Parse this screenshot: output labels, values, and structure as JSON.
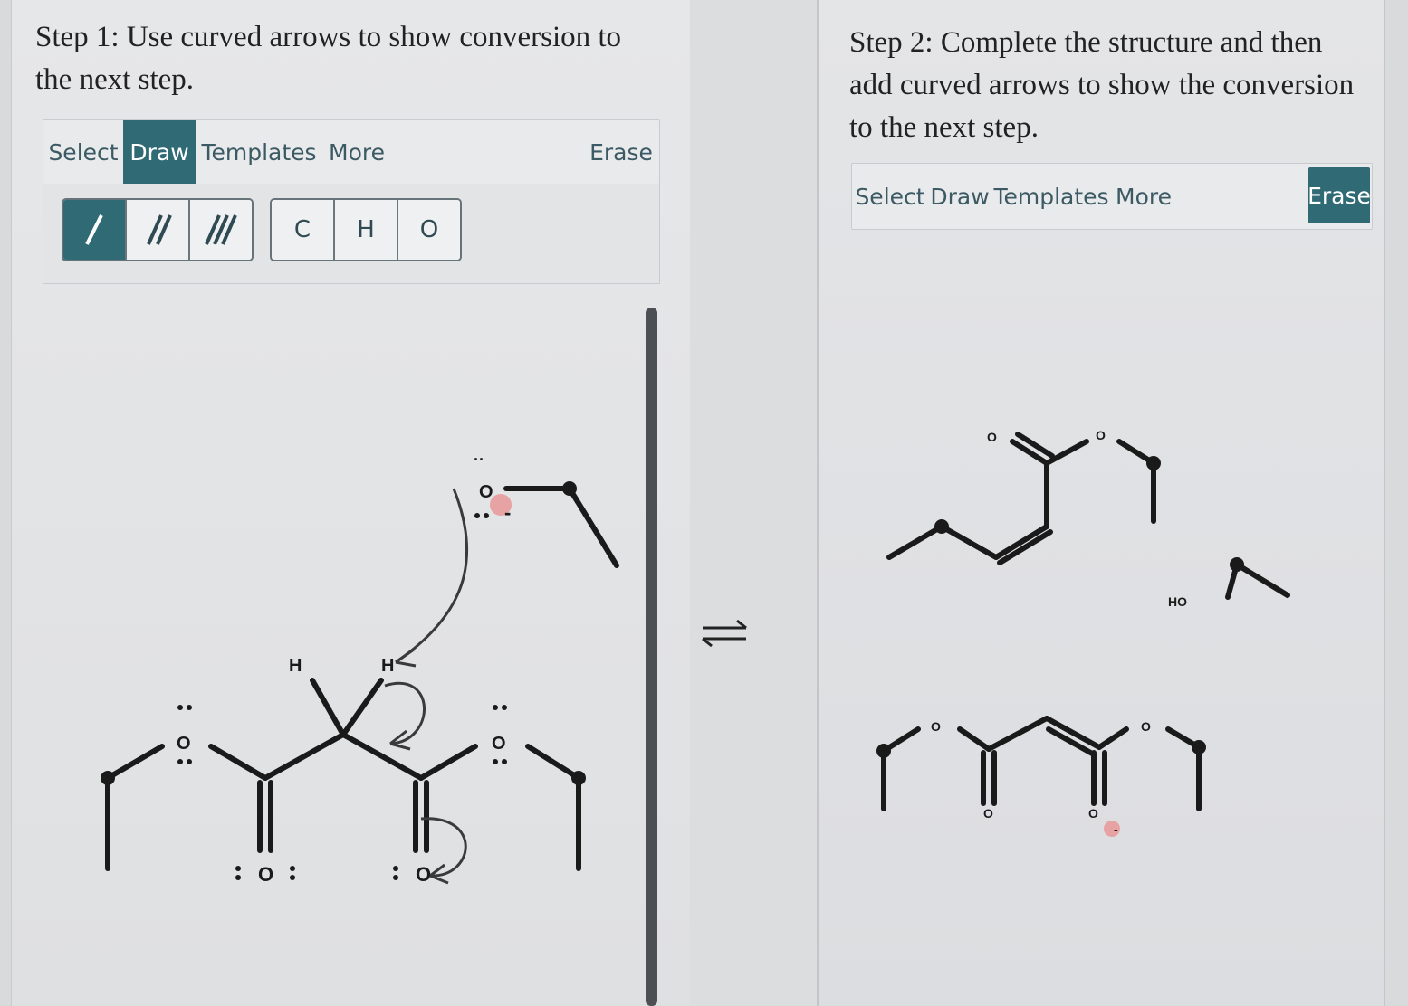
{
  "step1": {
    "title_line1": "Step 1: Use curved arrows to show conversion to",
    "title_line2": "the next step.",
    "tabs": [
      "Select",
      "Draw",
      "Templates",
      "More"
    ],
    "active_tab": "Draw",
    "erase_label": "Erase",
    "bond_tools": [
      "single-bond-icon",
      "double-bond-icon",
      "triple-bond-icon"
    ],
    "atom_tools": [
      "C",
      "H",
      "O"
    ],
    "labels": {
      "h_left": "H",
      "h_right": "H",
      "o_ester_left": "O",
      "o_carbonyl_left": "O",
      "o_carbonyl_right": "O",
      "o_ester_right": "O",
      "o_alkoxide": "O",
      "charge": "-"
    }
  },
  "equilibrium": {
    "icon": "equilibrium-arrows-icon"
  },
  "step2": {
    "title_line1": "Step 2: Complete the structure and then",
    "title_line2": "add curved arrows to show the conversion",
    "title_line3": "to the next step.",
    "tabs": [
      "Select",
      "Draw",
      "Templates",
      "More"
    ],
    "erase_label": "Erase",
    "labels": {
      "o_top_carbonyl": "O",
      "o_top_ester": "O",
      "ho": "HO",
      "o_bottom_left": "O",
      "o_bottom_carbonyl_left": "O",
      "o_bottom_carbonyl_right": "O",
      "o_bottom_right": "O",
      "charge": "-"
    }
  },
  "colors": {
    "accent": "#2f6a75",
    "charge_highlight": "#e7a2a4",
    "bond": "#1a1a1a"
  }
}
